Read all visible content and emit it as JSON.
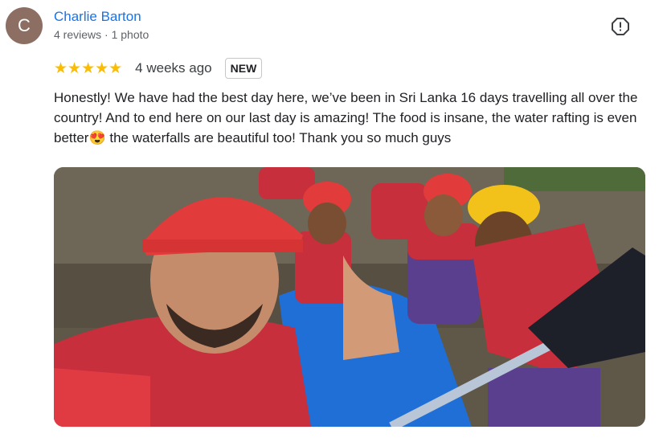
{
  "review": {
    "avatar_letter": "C",
    "author": "Charlie Barton",
    "meta": "4 reviews · 1 photo",
    "stars": "★★★★★",
    "rating": 5,
    "time": "4 weeks ago",
    "badge": "NEW",
    "text": "Honestly! We have had the best day here, we’ve been in Sri Lanka 16 days travelling all over the country! And to end here on our last day is amazing! The food is insane, the water rafting is even better😍 the waterfalls are beautiful too! Thank you so much guys"
  },
  "colors": {
    "author_link": "#1a73e8",
    "star": "#fbbc04",
    "avatar_bg": "#8d6e63"
  },
  "icons": {
    "report": "report-flag-icon"
  }
}
